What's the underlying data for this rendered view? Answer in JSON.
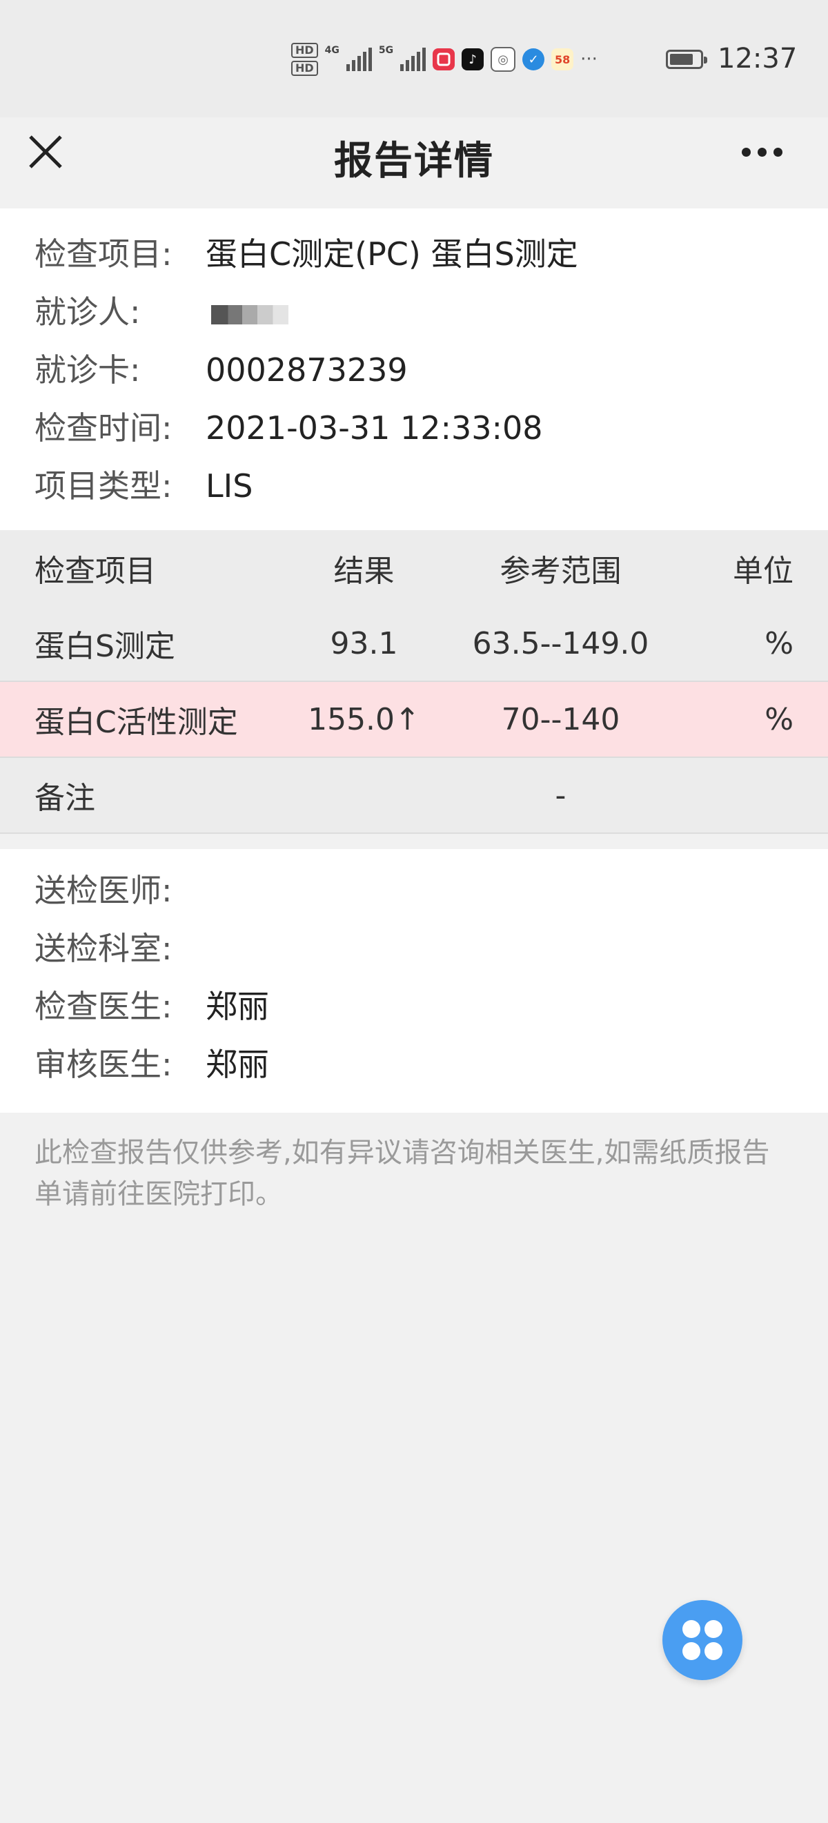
{
  "status_bar": {
    "sim1": "HD",
    "sim2": "HD",
    "net1": "4G",
    "net2": "5G",
    "time": "12:37",
    "more": "···"
  },
  "nav": {
    "title": "报告详情",
    "close_icon": "close-icon",
    "more_icon": "more-icon"
  },
  "info": {
    "item_label": "检查项目:",
    "item_value": "蛋白C测定(PC) 蛋白S测定",
    "patient_label": "就诊人:",
    "card_label": "就诊卡:",
    "card_value": "0002873239",
    "time_label": "检查时间:",
    "time_value": "2021-03-31 12:33:08",
    "type_label": "项目类型:",
    "type_value": "LIS"
  },
  "table": {
    "headers": [
      "检查项目",
      "结果",
      "参考范围",
      "单位"
    ],
    "rows": [
      {
        "name": "蛋白S测定",
        "result": "93.1",
        "reference": "63.5--149.0",
        "unit": "%"
      },
      {
        "name": "蛋白C活性测定",
        "result": "155.0↑",
        "reference": "70--140",
        "unit": "%"
      }
    ],
    "remark_label": "备注",
    "remark_value": "-"
  },
  "doctors": {
    "send_doctor_label": "送检医师:",
    "send_doctor_value": "",
    "send_dept_label": "送检科室:",
    "send_dept_value": "",
    "exam_doctor_label": "检查医生:",
    "exam_doctor_value": "郑丽",
    "review_doctor_label": "审核医生:",
    "review_doctor_value": "郑丽"
  },
  "footer_note": "此检查报告仅供参考,如有异议请咨询相关医生,如需纸质报告单请前往医院打印。",
  "colors": {
    "abnormal_row_bg": "#fde0e3",
    "fab_bg": "#4a9ef2"
  }
}
